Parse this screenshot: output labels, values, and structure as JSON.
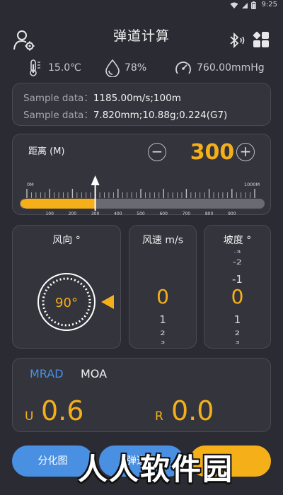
{
  "status_bar": {
    "time": "9:25"
  },
  "header": {
    "title": "弹道计算"
  },
  "environment": {
    "temperature": "15.0℃",
    "humidity": "78%",
    "pressure": "760.00mmHg"
  },
  "sample": {
    "label1": "Sample data：",
    "value1": "1185.00m/s;100m",
    "label2": "Sample data：",
    "value2": "7.820mm;10.88g;0.224(G7)"
  },
  "distance": {
    "label": "距离 (M)",
    "minus": "−",
    "plus": "+",
    "value": "300",
    "ruler_min_label": "0M",
    "ruler_max_label": "1000M",
    "ruler_min": 0,
    "ruler_max": 1000,
    "current": 300,
    "ticks": [
      "100",
      "200",
      "300",
      "400",
      "500",
      "600",
      "700",
      "800",
      "900"
    ]
  },
  "wind_dir": {
    "title": "风向 °",
    "value": "90°"
  },
  "wind_speed": {
    "title": "风速 m/s",
    "value": "0",
    "next1": "1",
    "next2": "2",
    "next3": "3"
  },
  "slope": {
    "title": "坡度 °",
    "value": "0",
    "prev3": "-3",
    "prev2": "-2",
    "prev1": "-1",
    "next1": "1",
    "next2": "2",
    "next3": "3"
  },
  "units": {
    "mrad": "MRAD",
    "moa": "MOA",
    "u_label": "U",
    "u_value": "0.6",
    "r_label": "R",
    "r_value": "0.0"
  },
  "buttons": {
    "reticle": "分化图",
    "table": "弹道表"
  },
  "watermark": "人人软件园",
  "colors": {
    "accent": "#f5b019",
    "primary_blue": "#4a90e2",
    "background": "#2b2b33"
  }
}
